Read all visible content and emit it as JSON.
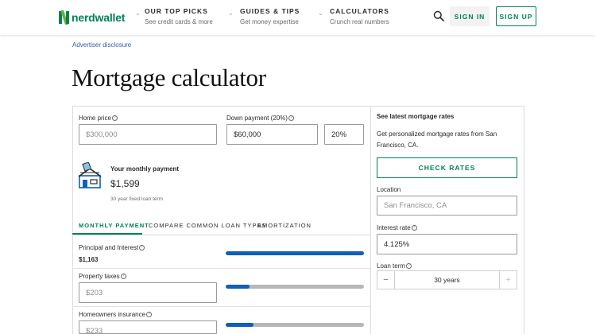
{
  "header": {
    "logo_text": "nerdwallet",
    "nav": [
      {
        "title": "OUR TOP PICKS",
        "subtitle": "See credit cards & more"
      },
      {
        "title": "GUIDES & TIPS",
        "subtitle": "Get money expertise"
      },
      {
        "title": "CALCULATORS",
        "subtitle": "Crunch real numbers"
      }
    ],
    "sign_in_label": "SIGN IN",
    "sign_up_label": "SIGN UP"
  },
  "disclosure": "Advertiser disclosure",
  "page_title": "Mortgage calculator",
  "calculator": {
    "home_price": {
      "label": "Home price",
      "placeholder": "$300,000"
    },
    "down_payment": {
      "label": "Down payment (20%)",
      "value": "$60,000",
      "percent": "20%"
    },
    "monthly": {
      "label": "Your monthly payment",
      "value": "$1,599",
      "note": "30 year fixed loan term"
    },
    "tabs": [
      "MONTHLY PAYMENT",
      "COMPARE COMMON LOAN TYPES",
      "AMORTIZATION"
    ],
    "active_tab": 0,
    "breakdown": [
      {
        "label": "Principal and Interest",
        "value": "$1,163",
        "fraction": 1.0
      },
      {
        "label": "Property taxes",
        "placeholder": "$203",
        "fraction": 0.17
      },
      {
        "label": "Homeowners insurance",
        "placeholder": "$233",
        "fraction": 0.2
      }
    ]
  },
  "rates_panel": {
    "title": "See latest mortgage rates",
    "description": "Get personalized mortgage rates from San Francisco, CA.",
    "check_rates_label": "CHECK RATES",
    "location": {
      "label": "Location",
      "placeholder": "San Francisco, CA"
    },
    "interest_rate": {
      "label": "Interest rate",
      "value": "4.125%"
    },
    "loan_term": {
      "label": "Loan term",
      "value": "30 years",
      "minus": "−",
      "plus": "+"
    }
  },
  "colors": {
    "brand": "#008254",
    "bar": "#0d5fb8",
    "track": "#b7b7b7"
  }
}
